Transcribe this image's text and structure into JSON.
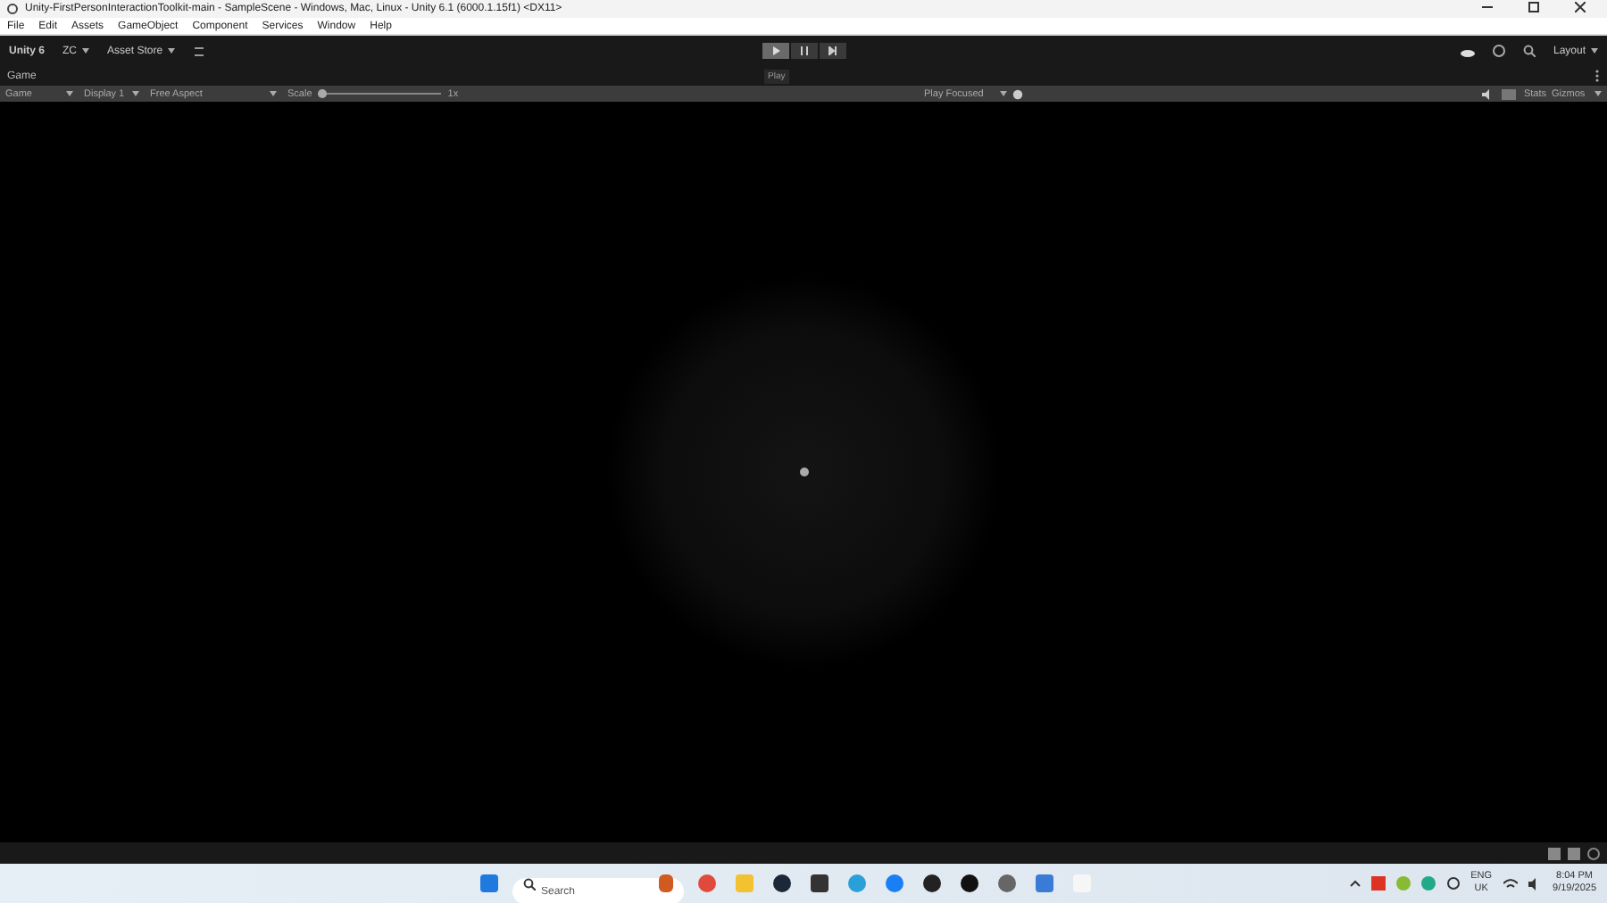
{
  "window": {
    "title": "Unity-FirstPersonInteractionToolkit-main - SampleScene - Windows, Mac, Linux - Unity 6.1 (6000.1.15f1) <DX11>"
  },
  "menu": [
    "File",
    "Edit",
    "Assets",
    "GameObject",
    "Component",
    "Services",
    "Window",
    "Help"
  ],
  "toolbar": {
    "account": "Unity 6",
    "user": "ZC",
    "store": "Asset Store",
    "tooltip": "Play",
    "layout": "Layout"
  },
  "game_tab": {
    "label": "Game"
  },
  "game_toolbar": {
    "view": "Game",
    "display": "Display 1",
    "aspect": "Free Aspect",
    "scale_label": "Scale",
    "scale": {
      "level": 0.02
    },
    "scale_reading": "1x",
    "play_mode": "Play Focused",
    "stats": "Stats",
    "gizmos": "Gizmos"
  },
  "taskbar": {
    "search": {
      "placeholder": "Search"
    },
    "language": "ENG",
    "region": "UK",
    "time": "8:04 PM",
    "date": "9/19/2025"
  }
}
